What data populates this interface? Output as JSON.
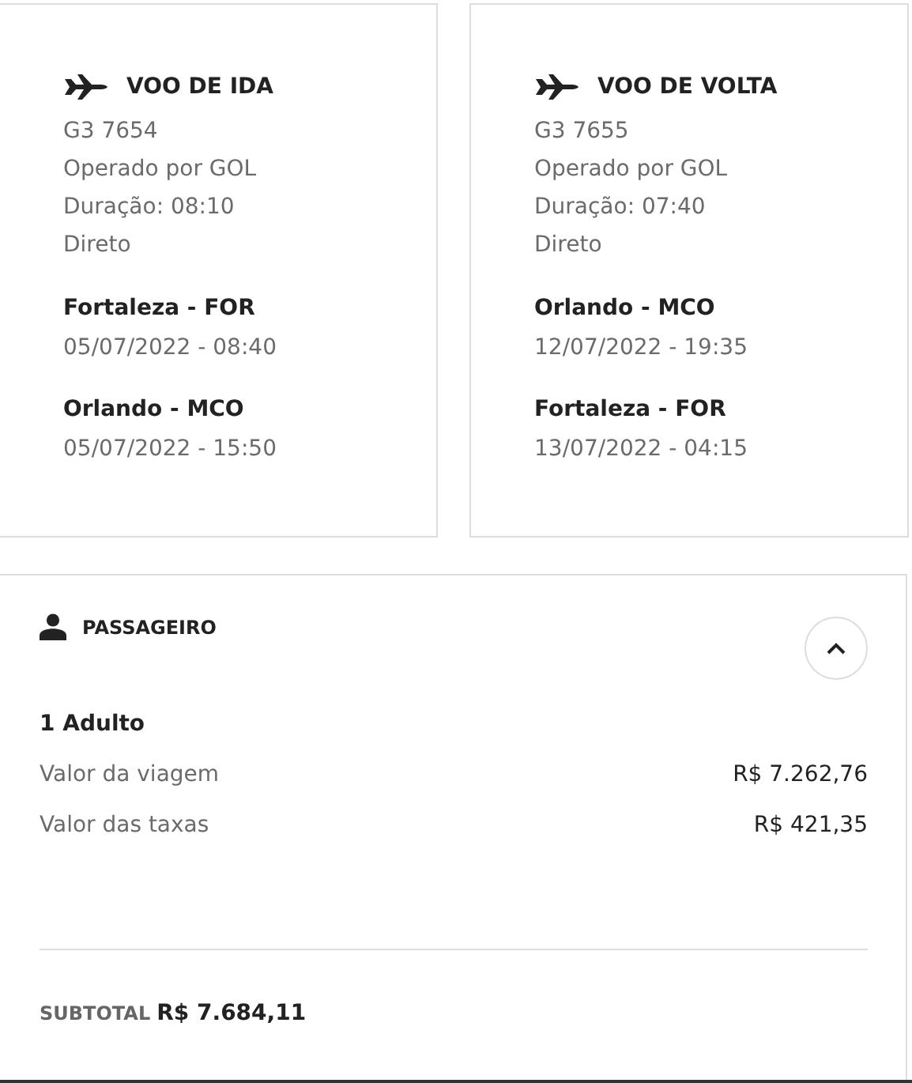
{
  "flights": [
    {
      "title": "VOO DE IDA",
      "code": "G3 7654",
      "operator": "Operado por GOL",
      "duration": "Duração: 08:10",
      "stops": "Direto",
      "segments": [
        {
          "place": "Fortaleza - FOR",
          "datetime": "05/07/2022 - 08:40"
        },
        {
          "place": "Orlando - MCO",
          "datetime": "05/07/2022 - 15:50"
        }
      ]
    },
    {
      "title": "VOO DE VOLTA",
      "code": "G3 7655",
      "operator": "Operado por GOL",
      "duration": "Duração: 07:40",
      "stops": "Direto",
      "segments": [
        {
          "place": "Orlando - MCO",
          "datetime": "12/07/2022 - 19:35"
        },
        {
          "place": "Fortaleza - FOR",
          "datetime": "13/07/2022 - 04:15"
        }
      ]
    }
  ],
  "passenger": {
    "title": "PASSAGEIRO",
    "expanded": true,
    "group": "1 Adulto",
    "items": [
      {
        "label": "Valor da viagem",
        "value": "R$ 7.262,76"
      },
      {
        "label": "Valor das taxas",
        "value": "R$ 421,35"
      }
    ],
    "subtotal_label": "SUBTOTAL",
    "subtotal_value": "R$ 7.684,11"
  }
}
